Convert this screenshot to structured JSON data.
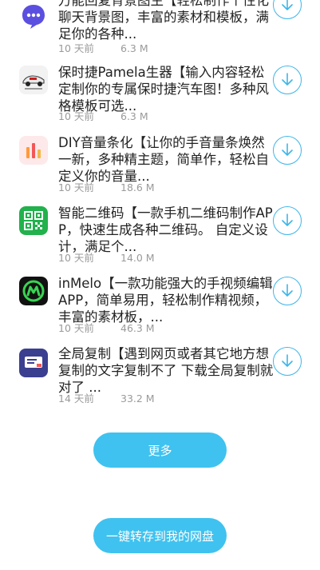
{
  "items": [
    {
      "desc": "万能回复背景图生【轻松制作个性化聊天背景图，丰富的素材和模板，满足你的各种...",
      "time": "10 天前",
      "size": "6.3 M",
      "icon": "chat-bubble-icon"
    },
    {
      "desc": "保时捷Pamela生器【输入内容轻松定制你的专属保时捷汽车图！多种风格模板可选...",
      "time": "10 天前",
      "size": "6.3 M",
      "icon": "porsche-car-icon"
    },
    {
      "desc": "DIY音量条化【让你的手音量条焕然一新，多种精主题，简单作，轻松自定义你的音量...",
      "time": "10 天前",
      "size": "18.6 M",
      "icon": "volume-bars-icon"
    },
    {
      "desc": "智能二维码【一款手机二维码制作APP，快速生成各种二维码。 自定义设计，满足个...",
      "time": "10 天前",
      "size": "14.0 M",
      "icon": "qr-code-icon"
    },
    {
      "desc": "inMelo【一款功能强大的手视频编辑APP，简单易用，轻松制作精视频，丰富的素材板，...",
      "time": "10 天前",
      "size": "46.3 M",
      "icon": "inmelo-logo-icon"
    },
    {
      "desc": "全局复制【遇到网页或者其它地方想复制的文字复制不了 下载全局复制就对了 ...",
      "time": "14 天前",
      "size": "33.2 M",
      "icon": "copy-app-icon"
    }
  ],
  "more_button": "更多",
  "save_button": "一键转存到我的网盘",
  "colors": {
    "accent": "#3fc2ef",
    "download_ring": "#3db6ea",
    "meta_text": "#9a9a9a"
  }
}
